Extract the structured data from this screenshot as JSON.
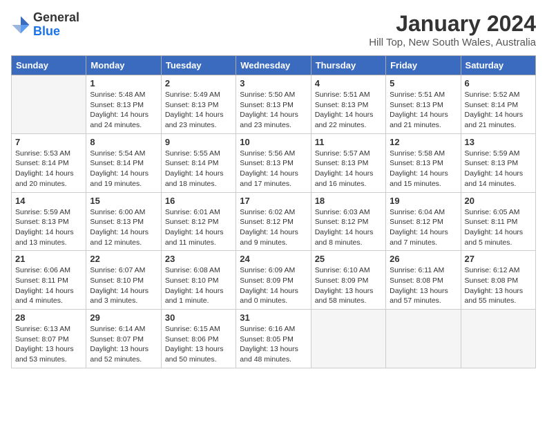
{
  "header": {
    "logo_general": "General",
    "logo_blue": "Blue",
    "month_title": "January 2024",
    "location": "Hill Top, New South Wales, Australia"
  },
  "days_of_week": [
    "Sunday",
    "Monday",
    "Tuesday",
    "Wednesday",
    "Thursday",
    "Friday",
    "Saturday"
  ],
  "weeks": [
    [
      {
        "day": "",
        "empty": true
      },
      {
        "day": "1",
        "sunrise": "Sunrise: 5:48 AM",
        "sunset": "Sunset: 8:13 PM",
        "daylight": "Daylight: 14 hours and 24 minutes."
      },
      {
        "day": "2",
        "sunrise": "Sunrise: 5:49 AM",
        "sunset": "Sunset: 8:13 PM",
        "daylight": "Daylight: 14 hours and 23 minutes."
      },
      {
        "day": "3",
        "sunrise": "Sunrise: 5:50 AM",
        "sunset": "Sunset: 8:13 PM",
        "daylight": "Daylight: 14 hours and 23 minutes."
      },
      {
        "day": "4",
        "sunrise": "Sunrise: 5:51 AM",
        "sunset": "Sunset: 8:13 PM",
        "daylight": "Daylight: 14 hours and 22 minutes."
      },
      {
        "day": "5",
        "sunrise": "Sunrise: 5:51 AM",
        "sunset": "Sunset: 8:13 PM",
        "daylight": "Daylight: 14 hours and 21 minutes."
      },
      {
        "day": "6",
        "sunrise": "Sunrise: 5:52 AM",
        "sunset": "Sunset: 8:14 PM",
        "daylight": "Daylight: 14 hours and 21 minutes."
      }
    ],
    [
      {
        "day": "7",
        "sunrise": "Sunrise: 5:53 AM",
        "sunset": "Sunset: 8:14 PM",
        "daylight": "Daylight: 14 hours and 20 minutes."
      },
      {
        "day": "8",
        "sunrise": "Sunrise: 5:54 AM",
        "sunset": "Sunset: 8:14 PM",
        "daylight": "Daylight: 14 hours and 19 minutes."
      },
      {
        "day": "9",
        "sunrise": "Sunrise: 5:55 AM",
        "sunset": "Sunset: 8:14 PM",
        "daylight": "Daylight: 14 hours and 18 minutes."
      },
      {
        "day": "10",
        "sunrise": "Sunrise: 5:56 AM",
        "sunset": "Sunset: 8:13 PM",
        "daylight": "Daylight: 14 hours and 17 minutes."
      },
      {
        "day": "11",
        "sunrise": "Sunrise: 5:57 AM",
        "sunset": "Sunset: 8:13 PM",
        "daylight": "Daylight: 14 hours and 16 minutes."
      },
      {
        "day": "12",
        "sunrise": "Sunrise: 5:58 AM",
        "sunset": "Sunset: 8:13 PM",
        "daylight": "Daylight: 14 hours and 15 minutes."
      },
      {
        "day": "13",
        "sunrise": "Sunrise: 5:59 AM",
        "sunset": "Sunset: 8:13 PM",
        "daylight": "Daylight: 14 hours and 14 minutes."
      }
    ],
    [
      {
        "day": "14",
        "sunrise": "Sunrise: 5:59 AM",
        "sunset": "Sunset: 8:13 PM",
        "daylight": "Daylight: 14 hours and 13 minutes."
      },
      {
        "day": "15",
        "sunrise": "Sunrise: 6:00 AM",
        "sunset": "Sunset: 8:13 PM",
        "daylight": "Daylight: 14 hours and 12 minutes."
      },
      {
        "day": "16",
        "sunrise": "Sunrise: 6:01 AM",
        "sunset": "Sunset: 8:12 PM",
        "daylight": "Daylight: 14 hours and 11 minutes."
      },
      {
        "day": "17",
        "sunrise": "Sunrise: 6:02 AM",
        "sunset": "Sunset: 8:12 PM",
        "daylight": "Daylight: 14 hours and 9 minutes."
      },
      {
        "day": "18",
        "sunrise": "Sunrise: 6:03 AM",
        "sunset": "Sunset: 8:12 PM",
        "daylight": "Daylight: 14 hours and 8 minutes."
      },
      {
        "day": "19",
        "sunrise": "Sunrise: 6:04 AM",
        "sunset": "Sunset: 8:12 PM",
        "daylight": "Daylight: 14 hours and 7 minutes."
      },
      {
        "day": "20",
        "sunrise": "Sunrise: 6:05 AM",
        "sunset": "Sunset: 8:11 PM",
        "daylight": "Daylight: 14 hours and 5 minutes."
      }
    ],
    [
      {
        "day": "21",
        "sunrise": "Sunrise: 6:06 AM",
        "sunset": "Sunset: 8:11 PM",
        "daylight": "Daylight: 14 hours and 4 minutes."
      },
      {
        "day": "22",
        "sunrise": "Sunrise: 6:07 AM",
        "sunset": "Sunset: 8:10 PM",
        "daylight": "Daylight: 14 hours and 3 minutes."
      },
      {
        "day": "23",
        "sunrise": "Sunrise: 6:08 AM",
        "sunset": "Sunset: 8:10 PM",
        "daylight": "Daylight: 14 hours and 1 minute."
      },
      {
        "day": "24",
        "sunrise": "Sunrise: 6:09 AM",
        "sunset": "Sunset: 8:09 PM",
        "daylight": "Daylight: 14 hours and 0 minutes."
      },
      {
        "day": "25",
        "sunrise": "Sunrise: 6:10 AM",
        "sunset": "Sunset: 8:09 PM",
        "daylight": "Daylight: 13 hours and 58 minutes."
      },
      {
        "day": "26",
        "sunrise": "Sunrise: 6:11 AM",
        "sunset": "Sunset: 8:08 PM",
        "daylight": "Daylight: 13 hours and 57 minutes."
      },
      {
        "day": "27",
        "sunrise": "Sunrise: 6:12 AM",
        "sunset": "Sunset: 8:08 PM",
        "daylight": "Daylight: 13 hours and 55 minutes."
      }
    ],
    [
      {
        "day": "28",
        "sunrise": "Sunrise: 6:13 AM",
        "sunset": "Sunset: 8:07 PM",
        "daylight": "Daylight: 13 hours and 53 minutes."
      },
      {
        "day": "29",
        "sunrise": "Sunrise: 6:14 AM",
        "sunset": "Sunset: 8:07 PM",
        "daylight": "Daylight: 13 hours and 52 minutes."
      },
      {
        "day": "30",
        "sunrise": "Sunrise: 6:15 AM",
        "sunset": "Sunset: 8:06 PM",
        "daylight": "Daylight: 13 hours and 50 minutes."
      },
      {
        "day": "31",
        "sunrise": "Sunrise: 6:16 AM",
        "sunset": "Sunset: 8:05 PM",
        "daylight": "Daylight: 13 hours and 48 minutes."
      },
      {
        "day": "",
        "empty": true
      },
      {
        "day": "",
        "empty": true
      },
      {
        "day": "",
        "empty": true
      }
    ]
  ]
}
